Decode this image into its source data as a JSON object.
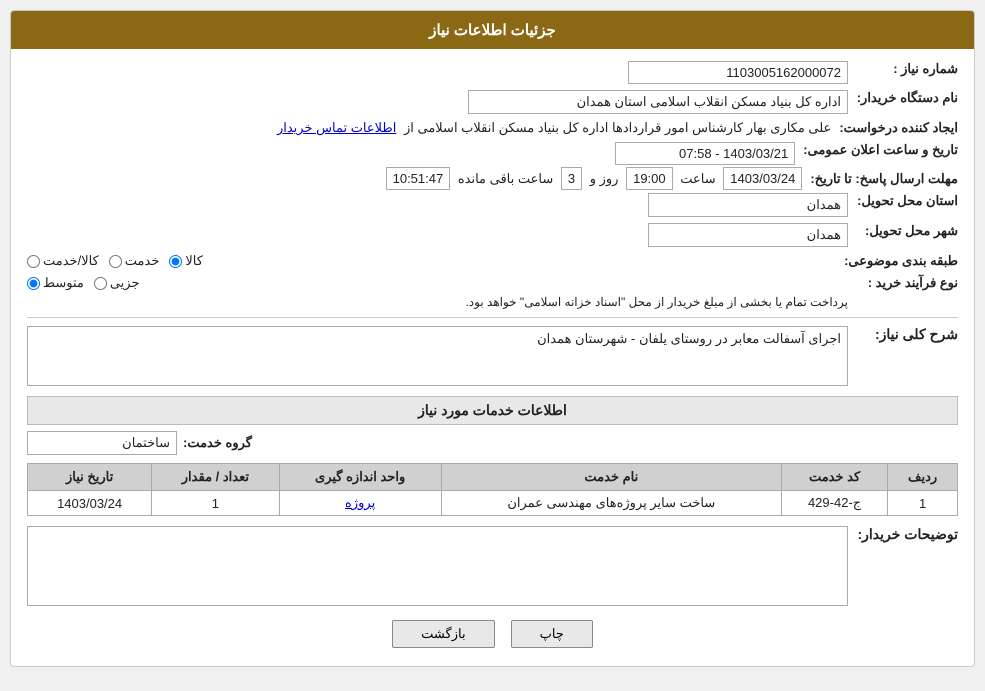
{
  "header": {
    "title": "جزئیات اطلاعات نیاز"
  },
  "fields": {
    "need_number_label": "شماره نیاز :",
    "need_number_value": "1103005162000072",
    "requester_label": "نام دستگاه خریدار:",
    "requester_value": "اداره کل بنیاد مسکن انقلاب اسلامی استان همدان",
    "creator_label": "ایجاد کننده درخواست:",
    "creator_value": "علی مکاری بهار کارشناس امور قراردادها اداره کل بنیاد مسکن انقلاب اسلامی از",
    "creator_link": "اطلاعات تماس خریدار",
    "announcement_date_label": "تاریخ و ساعت اعلان عمومی:",
    "announcement_date_value": "1403/03/21 - 07:58",
    "deadline_label": "مهلت ارسال پاسخ: تا تاریخ:",
    "deadline_date": "1403/03/24",
    "deadline_time_label": "ساعت",
    "deadline_time": "19:00",
    "deadline_day_label": "روز و",
    "deadline_days": "3",
    "deadline_remain_label": "ساعت باقی مانده",
    "deadline_remain": "10:51:47",
    "province_label": "استان محل تحویل:",
    "province_value": "همدان",
    "city_label": "شهر محل تحویل:",
    "city_value": "همدان",
    "category_label": "طبقه بندی موضوعی:",
    "category_kala": "کالا",
    "category_khedmat": "خدمت",
    "category_kala_khedmat": "کالا/خدمت",
    "purchase_type_label": "نوع فرآیند خرید :",
    "purchase_jozi": "جزیی",
    "purchase_motevaset": "متوسط",
    "purchase_note": "پرداخت تمام یا بخشی از مبلغ خریدار از محل \"اسناد خزانه اسلامی\" خواهد بود.",
    "description_label": "شرح کلی نیاز:",
    "description_value": "اجرای آسفالت معابر در روستای یلفان - شهرستان همدان",
    "services_section_label": "اطلاعات خدمات مورد نیاز",
    "service_group_label": "گروه خدمت:",
    "service_group_value": "ساختمان",
    "table_headers": {
      "row_num": "ردیف",
      "service_code": "کد خدمت",
      "service_name": "نام خدمت",
      "unit": "واحد اندازه گیری",
      "quantity": "تعداد / مقدار",
      "need_date": "تاریخ نیاز"
    },
    "table_rows": [
      {
        "row_num": "1",
        "service_code": "ج-42-429",
        "service_name": "ساخت سایر پروژه‌های مهندسی عمران",
        "unit": "پروژه",
        "quantity": "1",
        "need_date": "1403/03/24"
      }
    ],
    "buyer_desc_label": "توضیحات خریدار:",
    "back_button": "بازگشت",
    "print_button": "چاپ"
  }
}
